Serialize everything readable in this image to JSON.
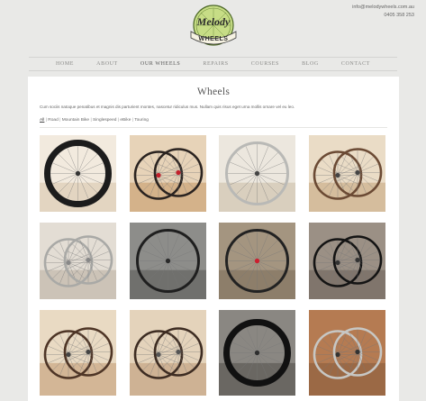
{
  "header": {
    "email": "info@melodywheels.com.au",
    "phone": "0405 358 253",
    "logo_top": "Melody",
    "logo_bottom": "WHEELS"
  },
  "nav": [
    {
      "label": "HOME",
      "active": false
    },
    {
      "label": "ABOUT",
      "active": false
    },
    {
      "label": "OUR WHEELS",
      "active": true
    },
    {
      "label": "REPAIRS",
      "active": false
    },
    {
      "label": "COURSES",
      "active": false
    },
    {
      "label": "BLOG",
      "active": false
    },
    {
      "label": "CONTACT",
      "active": false
    }
  ],
  "page": {
    "title": "Wheels",
    "intro": "Cum sociis natoque penatibus et magnis dis parturient montes, nascetur ridiculus mus. Nullam quis risus eget urna mollis ornare vel eu leo."
  },
  "filters": [
    {
      "label": "All",
      "selected": true
    },
    {
      "label": "Road",
      "selected": false
    },
    {
      "label": "Mountain Bike",
      "selected": false
    },
    {
      "label": "Singlespeed",
      "selected": false
    },
    {
      "label": "eBike",
      "selected": false
    },
    {
      "label": "Touring",
      "selected": false
    }
  ],
  "gallery": [
    {
      "name": "wheel-photo-black-road",
      "bg": "#f2eade",
      "ground": "#d9c7ad",
      "rim": "#1c1c1c",
      "hub": "#333333"
    },
    {
      "name": "wheel-photo-red-hub",
      "bg": "#e7d3b8",
      "ground": "#c89c6a",
      "rim": "#2a2320",
      "hub": "#c21f2a"
    },
    {
      "name": "wheel-photo-silver-rim",
      "bg": "#ece7de",
      "ground": "#cdbfa8",
      "rim": "#b9b9b6",
      "hub": "#444444"
    },
    {
      "name": "wheel-photo-pair-copper",
      "bg": "#eadcc6",
      "ground": "#c7a882",
      "rim": "#6b4a34",
      "hub": "#444444"
    },
    {
      "name": "wheel-photo-pair-silver",
      "bg": "#e3ddd4",
      "ground": "#bdb3a4",
      "rim": "#a9a9a6",
      "hub": "#888888"
    },
    {
      "name": "wheel-photo-mtb-brake",
      "bg": "#8d8d8a",
      "ground": "#5d5d5a",
      "rim": "#1f1f1f",
      "hub": "#2a2a2a"
    },
    {
      "name": "wheel-photo-red-hub-fence",
      "bg": "#a49580",
      "ground": "#7e6f5c",
      "rim": "#222222",
      "hub": "#cc1f2f"
    },
    {
      "name": "wheel-photo-pair-dark",
      "bg": "#9b9085",
      "ground": "#6e645b",
      "rim": "#141414",
      "hub": "#333333"
    },
    {
      "name": "wheel-photo-pair-bronze",
      "bg": "#e9dac3",
      "ground": "#c49f78",
      "rim": "#4e3526",
      "hub": "#444444"
    },
    {
      "name": "wheel-photo-pair-brown",
      "bg": "#e4d3bb",
      "ground": "#bf9d79",
      "rim": "#3d2c22",
      "hub": "#555555"
    },
    {
      "name": "wheel-photo-deep-carbon",
      "bg": "#8a8782",
      "ground": "#55524d",
      "rim": "#111111",
      "hub": "#2e2e2e"
    },
    {
      "name": "wheel-photo-wall-silver",
      "bg": "#b57b52",
      "ground": "#8a5d3d",
      "rim": "#c7c7c4",
      "hub": "#333333"
    }
  ]
}
